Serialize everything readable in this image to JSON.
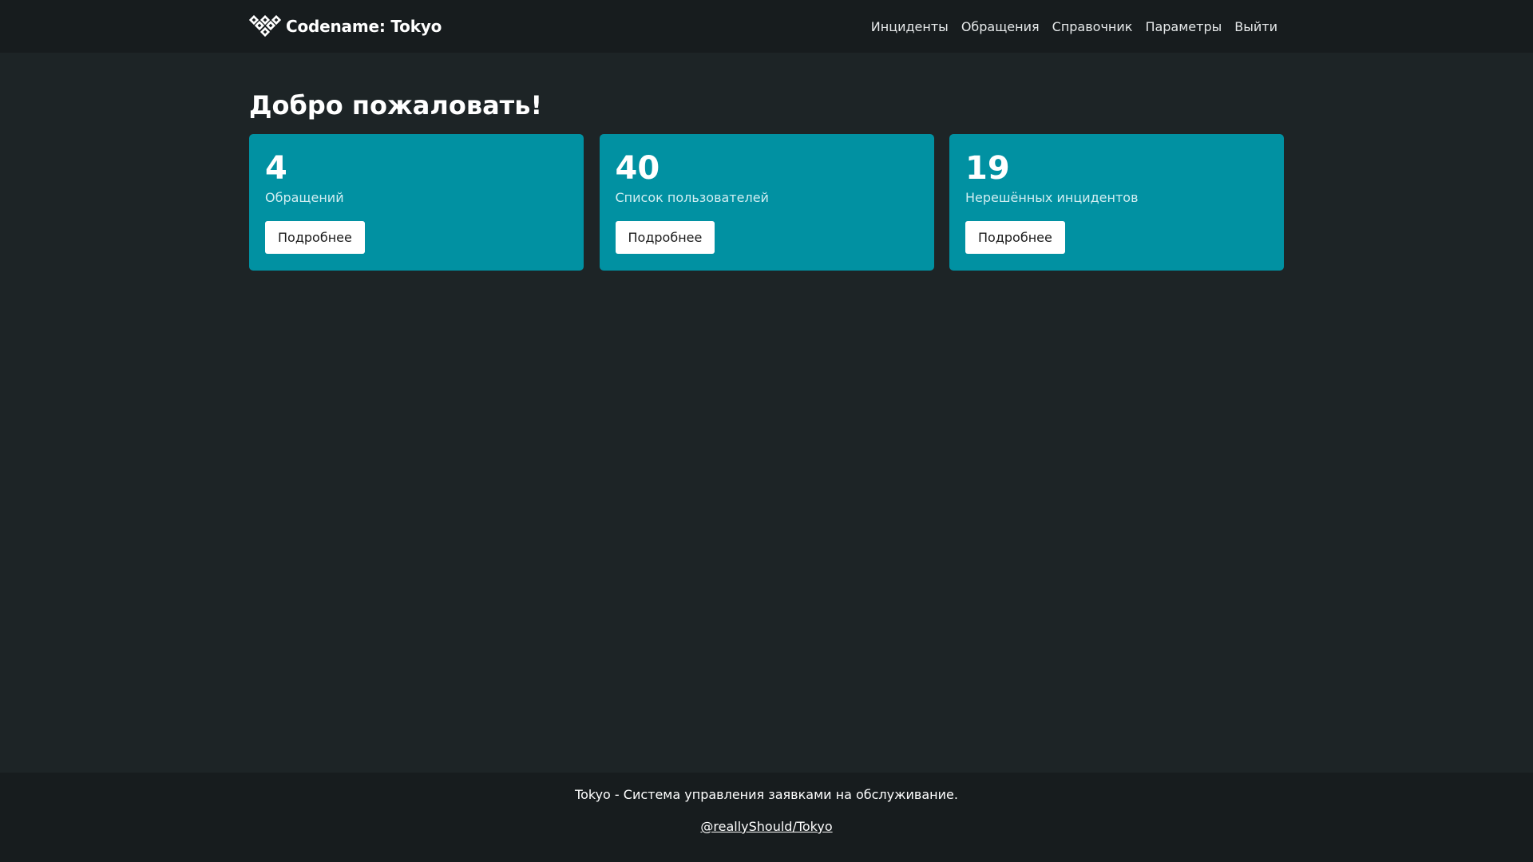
{
  "header": {
    "brand": "Codename: Tokyo",
    "logo_icon": "tokyo-diamonds-logo",
    "nav": [
      {
        "label": "Инциденты"
      },
      {
        "label": "Обращения"
      },
      {
        "label": "Справочник"
      },
      {
        "label": "Параметры"
      },
      {
        "label": "Выйти"
      }
    ]
  },
  "main": {
    "title": "Добро пожаловать!",
    "cards": [
      {
        "number": "4",
        "label": "Обращений",
        "button": "Подробнее"
      },
      {
        "number": "40",
        "label": "Список пользователей",
        "button": "Подробнее"
      },
      {
        "number": "19",
        "label": "Нерешённых инцидентов",
        "button": "Подробнее"
      }
    ]
  },
  "footer": {
    "text": "Tokyo - Система управления заявками на обслуживание.",
    "link": "@reallyShould/Tokyo"
  },
  "colors": {
    "background": "#1d2426",
    "navbar": "#171c1e",
    "card": "#0191a2",
    "button": "#ffffff"
  }
}
